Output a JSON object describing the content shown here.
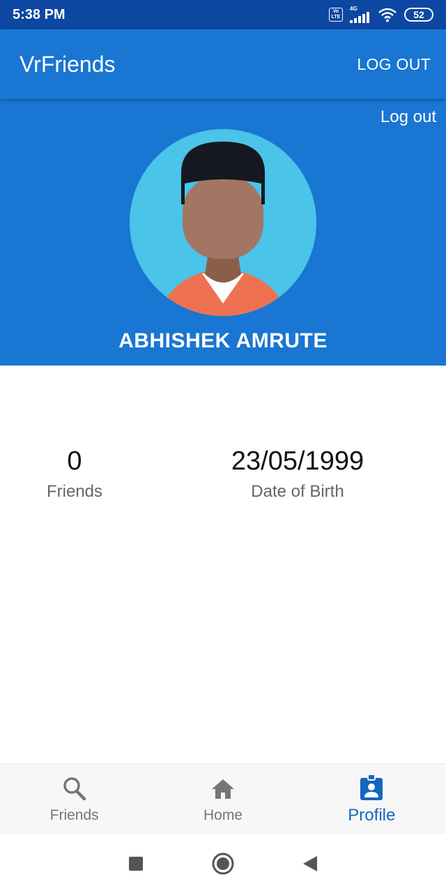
{
  "status_bar": {
    "time": "5:38 PM",
    "volte_top": "Vo",
    "volte_bottom": "LTE",
    "network_type": "4G",
    "battery_level": "52"
  },
  "app_bar": {
    "title": "VrFriends",
    "logout_label": "LOG OUT"
  },
  "profile": {
    "logout_link": "Log out",
    "name": "ABHISHEK AMRUTE"
  },
  "stats": {
    "friends_value": "0",
    "friends_label": "Friends",
    "dob_value": "23/05/1999",
    "dob_label": "Date of Birth"
  },
  "bottom_nav": {
    "items": [
      {
        "label": "Friends",
        "icon": "search-icon",
        "active": false
      },
      {
        "label": "Home",
        "icon": "home-icon",
        "active": false
      },
      {
        "label": "Profile",
        "icon": "profile-badge-icon",
        "active": true
      }
    ]
  },
  "colors": {
    "primary": "#1976d2",
    "status_bar": "#0d47a1",
    "active_nav": "#1565c0",
    "avatar_background": "#4ac4e9"
  }
}
